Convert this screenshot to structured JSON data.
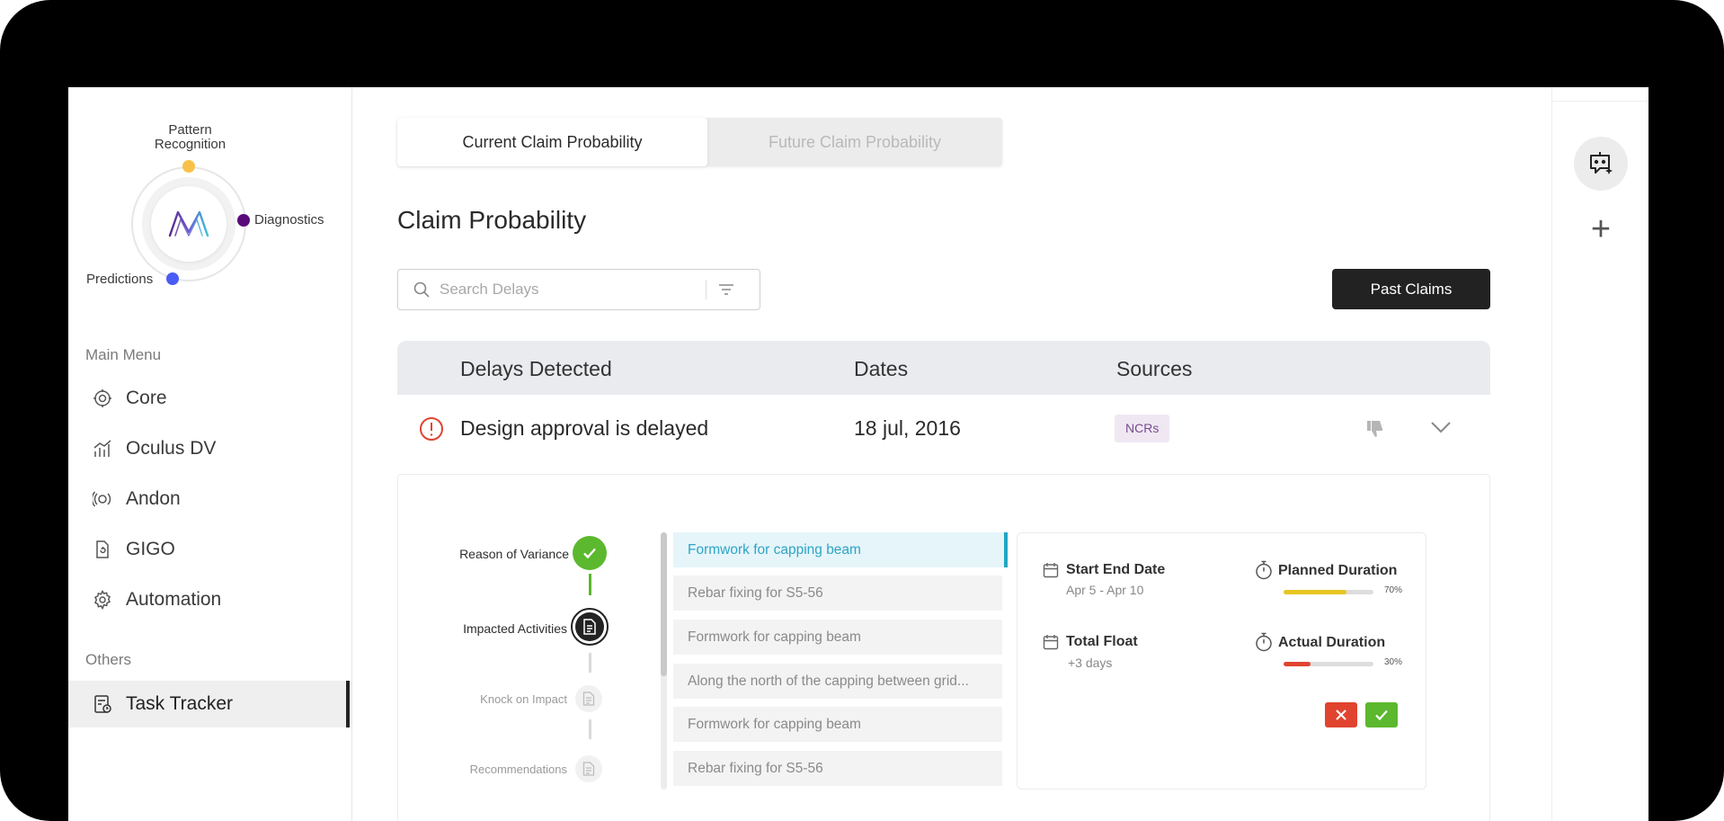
{
  "brand": {
    "orbit_labels": {
      "top": "Pattern Recognition",
      "right": "Diagnostics",
      "left": "Predictions"
    },
    "dot_colors": {
      "top": "#f9c14a",
      "right": "#5a0b7a",
      "left": "#4a5cf5"
    }
  },
  "sidebar": {
    "main_menu_title": "Main Menu",
    "main_items": [
      {
        "label": "Core",
        "icon": "core-icon"
      },
      {
        "label": "Oculus DV",
        "icon": "chart-icon"
      },
      {
        "label": "Andon",
        "icon": "signal-icon"
      },
      {
        "label": "GIGO",
        "icon": "document-refresh-icon"
      },
      {
        "label": "Automation",
        "icon": "gear-icon"
      }
    ],
    "others_title": "Others",
    "other_items": [
      {
        "label": "Task Tracker",
        "icon": "task-icon",
        "active": true
      }
    ]
  },
  "tabs": [
    {
      "label": "Current Claim Probability",
      "active": true
    },
    {
      "label": "Future Claim Probability",
      "active": false
    }
  ],
  "page_title": "Claim Probability",
  "search": {
    "placeholder": "Search Delays",
    "value": ""
  },
  "past_claims_label": "Past Claims",
  "table": {
    "headers": [
      "Delays Detected",
      "Dates",
      "Sources"
    ],
    "rows": [
      {
        "delay": "Design approval is delayed",
        "date": "18 jul, 2016",
        "source": "NCRs"
      }
    ]
  },
  "detail": {
    "steps": [
      {
        "label": "Reason of Variance",
        "state": "done"
      },
      {
        "label": "Impacted Activities",
        "state": "current"
      },
      {
        "label": "Knock on Impact",
        "state": "pending"
      },
      {
        "label": "Recommendations",
        "state": "pending"
      }
    ],
    "activities": [
      "Formwork for capping beam",
      "Rebar fixing for S5-56",
      "Formwork for capping beam",
      "Along the north of the capping between grid...",
      "Formwork for capping beam",
      "Rebar fixing for S5-56"
    ],
    "selected_activity_index": 0,
    "info": {
      "start_end_title": "Start End Date",
      "start_end_value": "Apr 5 - Apr 10",
      "total_float_title": "Total Float",
      "total_float_value": "+3 days",
      "planned_title": "Planned Duration",
      "planned_pct_label": "70%",
      "planned_pct": 0.7,
      "planned_color": "#e8c520",
      "actual_title": "Actual Duration",
      "actual_pct_label": "30%",
      "actual_pct": 0.3,
      "actual_color": "#e0442f"
    },
    "reject_color": "#e0442f",
    "accept_color": "#5cb82e"
  }
}
